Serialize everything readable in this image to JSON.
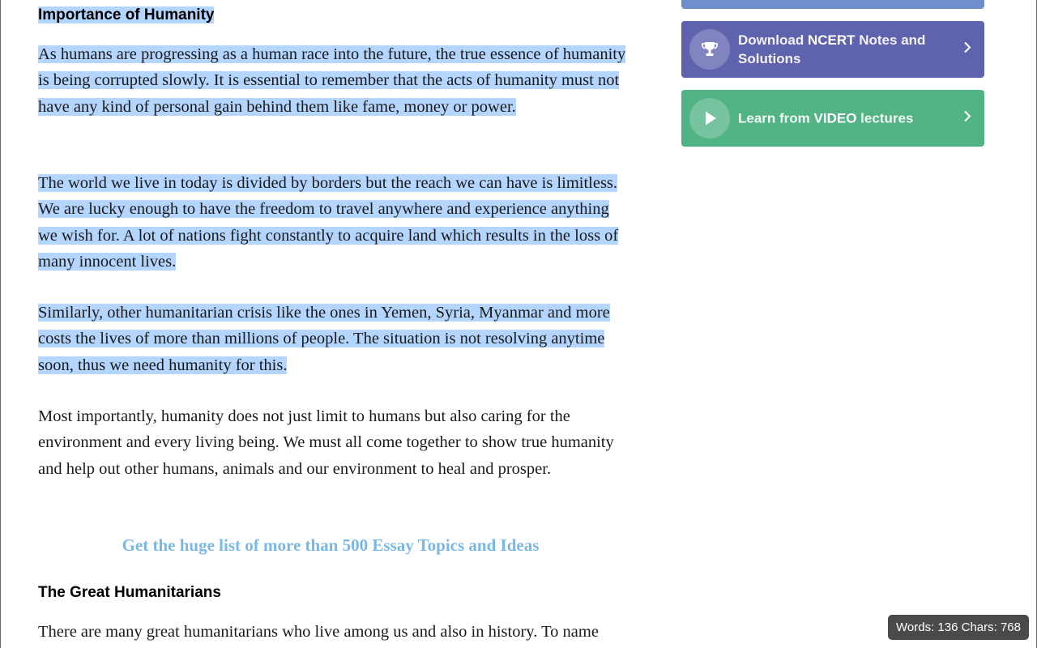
{
  "article": {
    "heading_importance": "Importance of Humanity",
    "paragraphs": [
      "As humans are progressing as a human race into the future, the true essence of humanity is being corrupted slowly. It is essential to remember that the acts of humanity must not have any kind of personal gain behind them like fame, money or power.",
      "The world we live in today is divided by borders but the reach we can have is limitless. We are lucky enough to have the freedom to travel anywhere and experience anything we wish for. A lot of nations fight constantly to acquire land which results in the loss of many innocent lives.",
      "Similarly, other humanitarian crisis like the ones in Yemen, Syria, Myanmar and more costs the lives of more than millions of people. The situation is not resolving anytime soon, thus we need humanity for this.",
      "Most importantly, humanity does not just limit to humans but also caring for the environment and every living being. We must all come together to show true humanity and help out other humans, animals and our environment to heal and prosper."
    ],
    "essay_link": "Get the huge list of more than 500 Essay Topics and Ideas",
    "heading_great": "The Great Humanitarians",
    "paragraph_great": "There are many great humanitarians who live among us and also in history. To name"
  },
  "sidebar": {
    "ncert": {
      "prefix": "Download ",
      "bold": "NCERT",
      "suffix": " Notes and Solutions",
      "icon": "trophy-icon"
    },
    "video": {
      "prefix": "Learn from ",
      "bold": "VIDEO",
      "suffix": " lectures",
      "icon": "play-icon"
    }
  },
  "status": {
    "word_count_label": "Words: 136 Chars: 768"
  },
  "colors": {
    "selection": "#b4d5fe",
    "link": "#7ab8e2",
    "ncert_button": "#5f62ad",
    "video_button": "#52b385",
    "top_button": "#6e8fc9",
    "badge_bg": "#4a4a4a"
  }
}
